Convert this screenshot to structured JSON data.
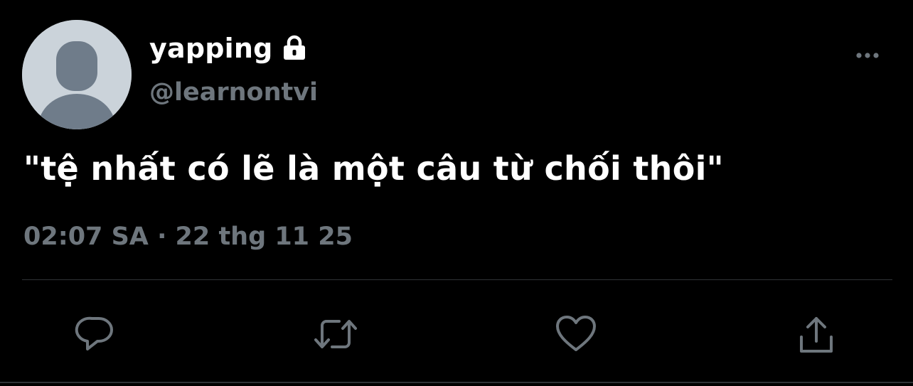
{
  "tweet": {
    "author": {
      "display_name": "yapping",
      "handle": "@learnontvi",
      "protected_icon": "lock-icon",
      "avatar": "default-avatar"
    },
    "text": "\"tệ nhất có lẽ là một câu từ chối thôi\"",
    "timestamp": "02:07 SA · 22 thg 11 25",
    "more_icon": "more-horizontal-icon"
  },
  "actions": [
    {
      "name": "reply",
      "icon": "reply-icon"
    },
    {
      "name": "retweet",
      "icon": "retweet-icon"
    },
    {
      "name": "like",
      "icon": "heart-icon"
    },
    {
      "name": "share",
      "icon": "share-icon"
    }
  ],
  "colors": {
    "background": "#000000",
    "primary_text": "#ffffff",
    "secondary_text": "#6e767d",
    "divider": "#2f3336",
    "avatar_bg": "#cbd3da",
    "avatar_figure": "#6f7c8a"
  }
}
